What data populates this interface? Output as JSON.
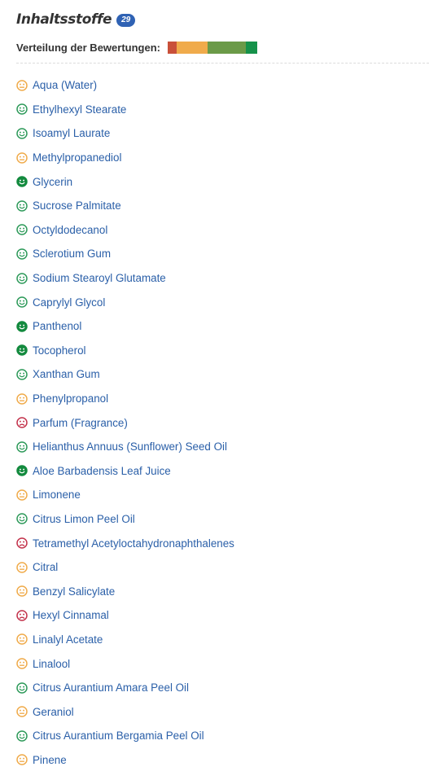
{
  "header": {
    "title": "Inhaltsstoffe",
    "count": "29"
  },
  "distribution": {
    "label": "Verteilung der Bewertungen:",
    "segments": [
      {
        "rating": "bad",
        "color": "#c9503a",
        "share": 0.1
      },
      {
        "rating": "neutral",
        "color": "#f0ab4b",
        "share": 0.35
      },
      {
        "rating": "good",
        "color": "#6b9a48",
        "share": 0.42
      },
      {
        "rating": "very-good",
        "color": "#16924a",
        "share": 0.13
      }
    ]
  },
  "colors": {
    "neutral": "#f0ab4b",
    "good": "#2e9a5a",
    "very-good": "#138a3e",
    "bad": "#c3334c",
    "link": "#2a5fa8"
  },
  "ingredients": [
    {
      "name": "Aqua (Water)",
      "rating": "neutral",
      "icon": "neutral-face-icon"
    },
    {
      "name": "Ethylhexyl Stearate",
      "rating": "good",
      "icon": "smiley-face-icon"
    },
    {
      "name": "Isoamyl Laurate",
      "rating": "good",
      "icon": "smiley-face-icon"
    },
    {
      "name": "Methylpropanediol",
      "rating": "neutral",
      "icon": "neutral-face-icon"
    },
    {
      "name": "Glycerin",
      "rating": "very-good",
      "icon": "smiley-face-filled-icon"
    },
    {
      "name": "Sucrose Palmitate",
      "rating": "good",
      "icon": "smiley-face-icon"
    },
    {
      "name": "Octyldodecanol",
      "rating": "good",
      "icon": "smiley-face-icon"
    },
    {
      "name": "Sclerotium Gum",
      "rating": "good",
      "icon": "smiley-face-icon"
    },
    {
      "name": "Sodium Stearoyl Glutamate",
      "rating": "good",
      "icon": "smiley-face-icon"
    },
    {
      "name": "Caprylyl Glycol",
      "rating": "good",
      "icon": "smiley-face-icon"
    },
    {
      "name": "Panthenol",
      "rating": "very-good",
      "icon": "smiley-face-filled-icon"
    },
    {
      "name": "Tocopherol",
      "rating": "very-good",
      "icon": "smiley-face-filled-icon"
    },
    {
      "name": "Xanthan Gum",
      "rating": "good",
      "icon": "smiley-face-icon"
    },
    {
      "name": "Phenylpropanol",
      "rating": "neutral",
      "icon": "neutral-face-icon"
    },
    {
      "name": "Parfum (Fragrance)",
      "rating": "bad",
      "icon": "sad-face-icon"
    },
    {
      "name": "Helianthus Annuus (Sunflower) Seed Oil",
      "rating": "good",
      "icon": "smiley-face-icon"
    },
    {
      "name": "Aloe Barbadensis Leaf Juice",
      "rating": "very-good",
      "icon": "smiley-face-filled-icon"
    },
    {
      "name": "Limonene",
      "rating": "neutral",
      "icon": "neutral-face-icon"
    },
    {
      "name": "Citrus Limon Peel Oil",
      "rating": "good",
      "icon": "smiley-face-icon"
    },
    {
      "name": "Tetramethyl Acetyloctahydronaphthalenes",
      "rating": "bad",
      "icon": "sad-face-icon"
    },
    {
      "name": "Citral",
      "rating": "neutral",
      "icon": "neutral-face-icon"
    },
    {
      "name": "Benzyl Salicylate",
      "rating": "neutral",
      "icon": "neutral-face-icon"
    },
    {
      "name": "Hexyl Cinnamal",
      "rating": "bad",
      "icon": "sad-face-icon"
    },
    {
      "name": "Linalyl Acetate",
      "rating": "neutral",
      "icon": "neutral-face-icon"
    },
    {
      "name": "Linalool",
      "rating": "neutral",
      "icon": "neutral-face-icon"
    },
    {
      "name": "Citrus Aurantium Amara Peel Oil",
      "rating": "good",
      "icon": "smiley-face-icon"
    },
    {
      "name": "Geraniol",
      "rating": "neutral",
      "icon": "neutral-face-icon"
    },
    {
      "name": "Citrus Aurantium Bergamia Peel Oil",
      "rating": "good",
      "icon": "smiley-face-icon"
    },
    {
      "name": "Pinene",
      "rating": "neutral",
      "icon": "neutral-face-icon"
    }
  ]
}
